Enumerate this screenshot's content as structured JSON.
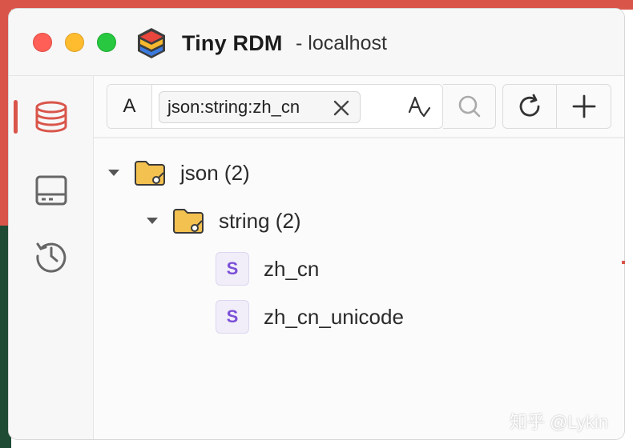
{
  "window": {
    "app_name": "Tiny RDM",
    "subtitle": "- localhost"
  },
  "activity_bar": {
    "items": [
      {
        "icon": "database-icon",
        "active": true
      },
      {
        "icon": "server-icon",
        "active": false
      },
      {
        "icon": "history-icon",
        "active": false
      }
    ],
    "accent": "#d9554a"
  },
  "toolbar": {
    "type_filter_label": "A",
    "filter_tag": "json:string:zh_cn",
    "icons": [
      "close-icon",
      "match-case-icon",
      "search-icon",
      "refresh-icon",
      "plus-icon"
    ]
  },
  "tree": {
    "nodes": [
      {
        "label": "json (2)",
        "type": "folder",
        "expanded": true,
        "level": 0
      },
      {
        "label": "string (2)",
        "type": "folder",
        "expanded": true,
        "level": 1
      },
      {
        "label": "zh_cn",
        "type": "key",
        "key_type": "S",
        "level": 2
      },
      {
        "label": "zh_cn_unicode",
        "type": "key",
        "key_type": "S",
        "level": 2
      }
    ]
  },
  "watermark": "知乎 @Lykin",
  "colors": {
    "folder": "#f3c14f",
    "key_badge_text": "#7c4fd8",
    "key_badge_bg": "#f1eef9"
  }
}
